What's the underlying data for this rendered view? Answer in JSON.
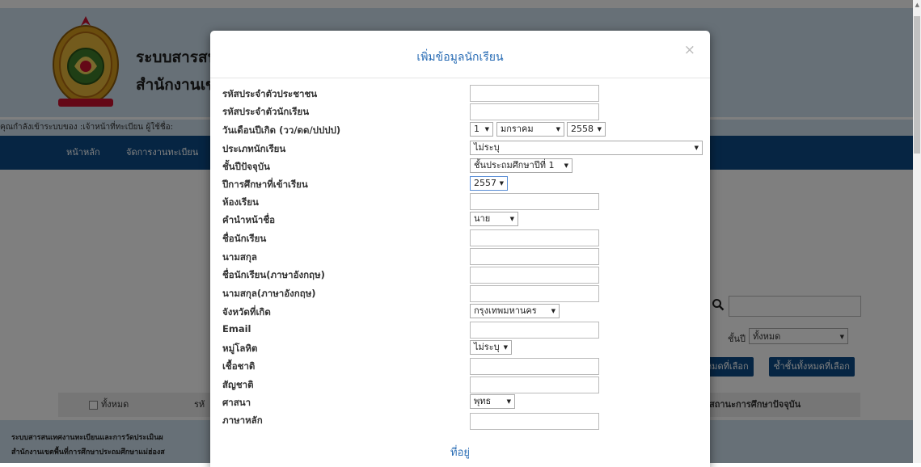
{
  "site": {
    "title_line1": "ระบบสารสนเทศ",
    "title_line2": "สำนักงานเขต",
    "user_line": "คุณกำลังเข้าระบบของ :เจ้าหน้าที่ทะเบียน ผู้ใช้ชื่อ:"
  },
  "nav": {
    "home": "หน้าหลัก",
    "registry": "จัดการงานทะเบียน"
  },
  "search": {
    "value": ""
  },
  "grade_filter": {
    "label": "ชั้นปี",
    "selected": "ทั้งหมด"
  },
  "buttons": {
    "select_all_chosen": "หมดที่เลือก",
    "repeat_grade": "ซ้ำชั้นทั้งหมดที่เลือก"
  },
  "table": {
    "all_checkbox_label": "ทั้งหมด",
    "col_code": "รหั",
    "col_status": "สถานะการศึกษาปัจจุบัน"
  },
  "footer": {
    "line1": "ระบบสารสนเทศงานทะเบียนและการวัดประเมินผ",
    "line2": "สำนักงานเขตพื้นที่การศึกษาประถมศึกษาแม่ฮ่องส"
  },
  "modal": {
    "title": "เพิ่มข้อมูลนักเรียน",
    "close": "×",
    "labels": {
      "citizen_id": "รหัสประจำตัวประชาชน",
      "student_id": "รหัสประจำตัวนักเรียน",
      "birthdate": "วันเดือนปีเกิด (วว/ดด/ปปปป)",
      "student_type": "ประเภทนักเรียน",
      "current_grade": "ชั้นปีปัจจุบัน",
      "entry_year": "ปีการศึกษาที่เข้าเรียน",
      "classroom": "ห้องเรียน",
      "prefix": "คำนำหน้าชื่อ",
      "first_name": "ชื่อนักเรียน",
      "last_name": "นามสกุล",
      "first_name_en": "ชื่อนักเรียน(ภาษาอังกฤษ)",
      "last_name_en": "นามสกุล(ภาษาอังกฤษ)",
      "birth_province": "จังหวัดที่เกิด",
      "email": "Email",
      "blood_type": "หมู่โลหิต",
      "ethnicity": "เชื้อชาติ",
      "nationality": "สัญชาติ",
      "religion": "ศาสนา",
      "main_language": "ภาษาหลัก"
    },
    "values": {
      "birth_day": "1",
      "birth_month": "มกราคม",
      "birth_year": "2558",
      "student_type": "ไม่ระบุ",
      "current_grade": "ชั้นประถมศึกษาปีที่ 1",
      "entry_year": "2557",
      "prefix": "นาย",
      "birth_province": "กรุงเทพมหานคร",
      "blood_type": "ไม่ระบุ",
      "religion": "พุทธ"
    },
    "address_heading": "ที่อยู่"
  }
}
